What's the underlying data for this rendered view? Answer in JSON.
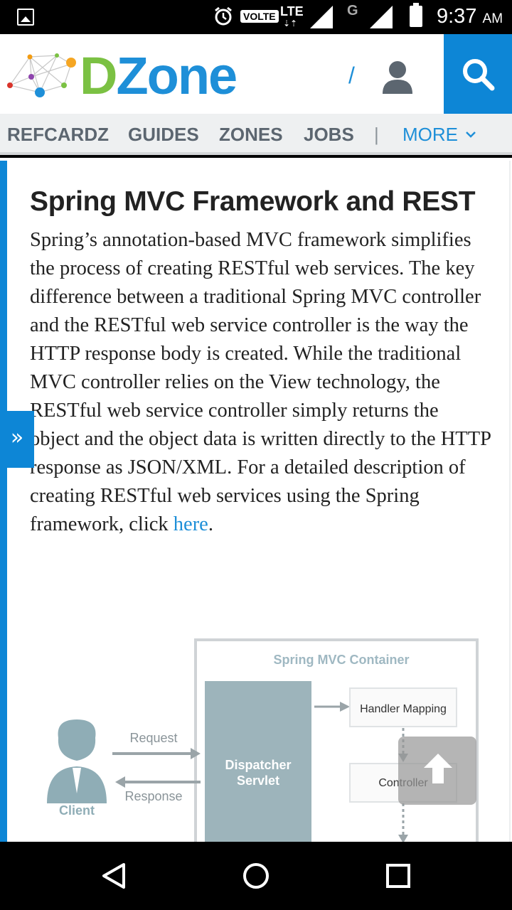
{
  "status_bar": {
    "volte": "VOLTE",
    "network": "LTE",
    "network2": "G",
    "time": "9:37",
    "ampm": "AM"
  },
  "header": {
    "logo_d": "D",
    "logo_zone": "Zone",
    "slash": "/",
    "brand_green": "#7bc143",
    "brand_blue": "#1e8fd8"
  },
  "nav": {
    "items": [
      "REFCARDZ",
      "GUIDES",
      "ZONES",
      "JOBS"
    ],
    "separator": "|",
    "more": "MORE"
  },
  "article": {
    "title": "Spring MVC Framework and REST",
    "body": "Spring’s annotation-based MVC framework simplifies the process of creating RESTful web services. The key difference between a traditional Spring MVC controller and the RESTful web service controller is the way the HTTP response body is created. While the traditional MVC controller relies on the View technology, the RESTful web service controller simply returns the object and the object data is written directly to the HTTP response as JSON/XML.  For a detailed description of creating RESTful web services using the Spring framework, click ",
    "link": "here",
    "end": "."
  },
  "diagram": {
    "container_label": "Spring MVC Container",
    "dispatcher_line1": "Dispatcher",
    "dispatcher_line2": "Servlet",
    "handler_mapping": "Handler Mapping",
    "controller": "Controller",
    "request": "Request",
    "response": "Response",
    "client": "Client"
  },
  "icons": {
    "expand": "double-chevron-right-icon",
    "scroll_top": "arrow-up-icon",
    "search": "search-icon",
    "user": "user-icon"
  }
}
